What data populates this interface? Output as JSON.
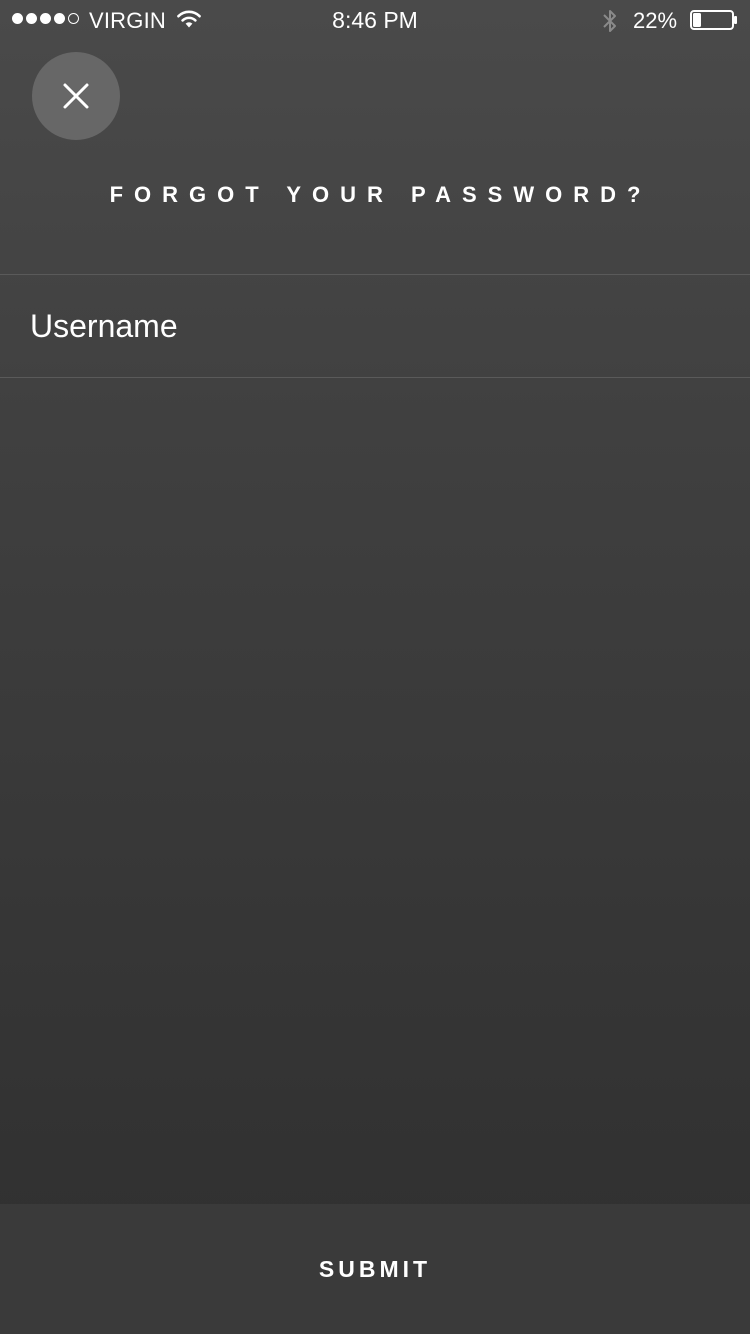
{
  "status_bar": {
    "signal_strength": 4,
    "signal_max": 5,
    "carrier": "VIRGIN",
    "time": "8:46 PM",
    "battery_percent": "22%",
    "battery_level": 0.22,
    "icons": [
      "wifi-icon",
      "bluetooth-icon",
      "battery-icon"
    ]
  },
  "header": {
    "close_icon": "close-icon",
    "title": "FORGOT YOUR PASSWORD?"
  },
  "form": {
    "username_placeholder": "Username",
    "username_value": ""
  },
  "footer": {
    "submit_label": "SUBMIT"
  },
  "colors": {
    "background_top": "#4a4a4a",
    "background_bottom": "#2f2f2f",
    "close_button_bg": "#676767",
    "submit_bar_bg": "#3a3a3a",
    "text": "#ffffff"
  }
}
